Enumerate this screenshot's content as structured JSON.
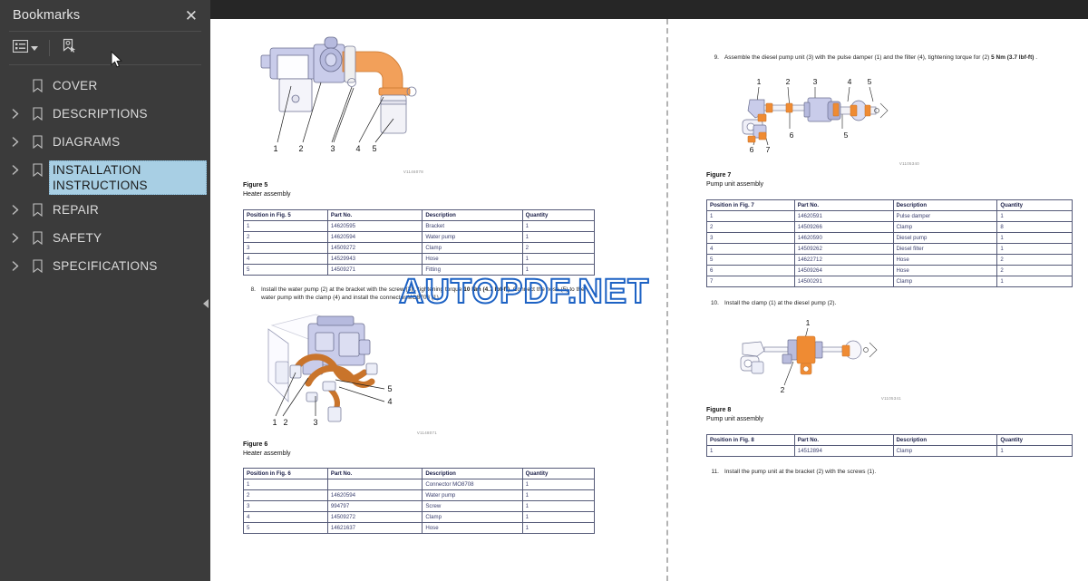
{
  "sidebar": {
    "title": "Bookmarks",
    "close_label": "✕",
    "toolbar": {
      "list_view_icon": "list-view-icon",
      "dropdown_icon": "chevron-down-icon",
      "new_bookmark_icon": "new-bookmark-icon"
    },
    "items": [
      {
        "label": "COVER",
        "expandable": false,
        "selected": false
      },
      {
        "label": "DESCRIPTIONS",
        "expandable": true,
        "selected": false
      },
      {
        "label": "DIAGRAMS",
        "expandable": true,
        "selected": false
      },
      {
        "label": "INSTALLATION INSTRUCTIONS",
        "expandable": true,
        "selected": true
      },
      {
        "label": "REPAIR",
        "expandable": true,
        "selected": false
      },
      {
        "label": "SAFETY",
        "expandable": true,
        "selected": false
      },
      {
        "label": "SPECIFICATIONS",
        "expandable": true,
        "selected": false
      }
    ],
    "collapse_icon": "collapse-left-icon"
  },
  "watermark": {
    "text": "AUTOPDF.NET",
    "color": "#1d62c4"
  },
  "colors": {
    "sidebar_bg": "#3b3b3b",
    "selection": "#a8cfe4",
    "topbar": "#262626",
    "accent_orange": "#ef8b33",
    "accent_lilac": "#b9bcdd"
  },
  "left_page": {
    "figure5": {
      "illustration_id": "V1146078",
      "callouts": [
        "1",
        "2",
        "3",
        "4",
        "5"
      ],
      "caption_title": "Figure 5",
      "caption_sub": "Heater assembly"
    },
    "table5": {
      "headers": [
        "Position in Fig. 5",
        "Part No.",
        "Description",
        "Quantity"
      ],
      "rows": [
        [
          "1",
          "14620595",
          "Bracket",
          "1"
        ],
        [
          "2",
          "14620594",
          "Water pump",
          "1"
        ],
        [
          "3",
          "14509272",
          "Clamp",
          "2"
        ],
        [
          "4",
          "14529943",
          "Hose",
          "1"
        ],
        [
          "5",
          "14509271",
          "Fitting",
          "1"
        ]
      ]
    },
    "step8": {
      "number": "8.",
      "text_a": "Install the water pump (2) at the bracket with the screw (3) , tightening torque ",
      "text_b": "10 Nm (4.7 lbf-ft)",
      "text_c": ". Connect the hose (5) to the water pump with the clamp (4) and install the connector MO8708 (1)."
    },
    "figure6": {
      "illustration_id": "V1148071",
      "callouts": [
        "1",
        "2",
        "3",
        "4",
        "5"
      ],
      "caption_title": "Figure 6",
      "caption_sub": "Heater assembly"
    },
    "table6": {
      "headers": [
        "Position in Fig. 6",
        "Part No.",
        "Description",
        "Quantity"
      ],
      "rows": [
        [
          "1",
          "",
          "Connector MO8708",
          "1"
        ],
        [
          "2",
          "14620594",
          "Water pump",
          "1"
        ],
        [
          "3",
          "994797",
          "Screw",
          "1"
        ],
        [
          "4",
          "14509272",
          "Clamp",
          "1"
        ],
        [
          "5",
          "14621637",
          "Hose",
          "1"
        ]
      ]
    }
  },
  "right_page": {
    "step9": {
      "number": "9.",
      "text_a": "Assemble the diesel pump unit (3) with the pulse damper (1) and the filter (4), tightening torque for (2) ",
      "text_b": "5 Nm (3.7 lbf-ft)",
      "text_c": " ."
    },
    "figure7": {
      "illustration_id": "V1105340",
      "callouts": [
        "1",
        "2",
        "3",
        "4",
        "5",
        "6",
        "7"
      ],
      "caption_title": "Figure 7",
      "caption_sub": "Pump unit assembly"
    },
    "table7": {
      "headers": [
        "Position in Fig. 7",
        "Part No.",
        "Description",
        "Quantity"
      ],
      "rows": [
        [
          "1",
          "14620591",
          "Pulse damper",
          "1"
        ],
        [
          "2",
          "14509266",
          "Clamp",
          "8"
        ],
        [
          "3",
          "14620590",
          "Diesel pump",
          "1"
        ],
        [
          "4",
          "14509262",
          "Diesel filter",
          "1"
        ],
        [
          "5",
          "14622712",
          "Hose",
          "2"
        ],
        [
          "6",
          "14509264",
          "Hose",
          "2"
        ],
        [
          "7",
          "14500291",
          "Clamp",
          "1"
        ]
      ]
    },
    "step10": {
      "number": "10.",
      "text": "Install the clamp (1) at the diesel pump (2)."
    },
    "figure8": {
      "illustration_id": "V1105341",
      "callouts": [
        "1",
        "2"
      ],
      "caption_title": "Figure 8",
      "caption_sub": "Pump unit assembly"
    },
    "table8": {
      "headers": [
        "Position in Fig. 8",
        "Part No.",
        "Description",
        "Quantity"
      ],
      "rows": [
        [
          "1",
          "14512894",
          "Clamp",
          "1"
        ]
      ]
    },
    "step11": {
      "number": "11.",
      "text": "Install the pump unit at the bracket (2) with the screws (1)."
    }
  }
}
